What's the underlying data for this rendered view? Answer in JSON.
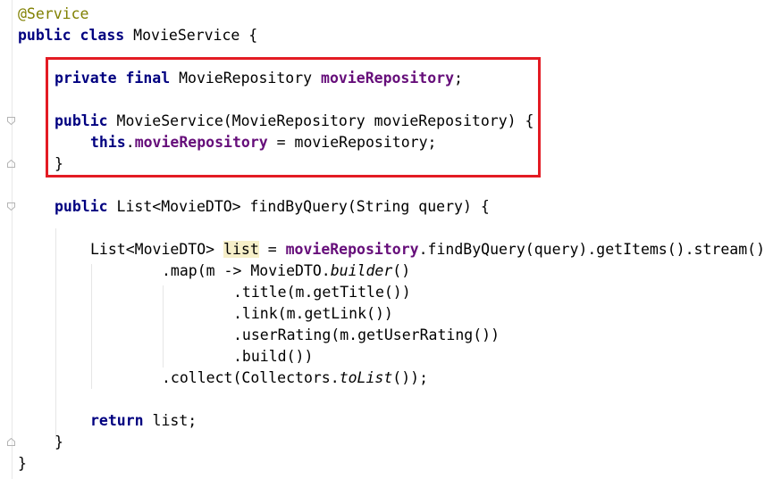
{
  "code": {
    "l1_annotation": "@Service",
    "l2_kw": "public class",
    "l2_rest": " MovieService {",
    "l3_kw": "private final",
    "l3_type": " MovieRepository ",
    "l3_field": "movieRepository",
    "l3_end": ";",
    "l4_kw": "public",
    "l4_rest": " MovieService(MovieRepository movieRepository) {",
    "l5_kw": "this",
    "l5_dot": ".",
    "l5_field": "movieRepository",
    "l5_rest": " = movieRepository;",
    "l6": "}",
    "l7_kw": "public",
    "l7_rest": " List<MovieDTO> findByQuery(String query) {",
    "l8_a": "List<MovieDTO> ",
    "l8_var": "list",
    "l8_b": " = ",
    "l8_field": "movieRepository",
    "l8_c": ".findByQuery(query).getItems().stream()",
    "l9_a": ".map(m -> MovieDTO.",
    "l9_italic": "builder",
    "l9_b": "()",
    "l10": ".title(m.getTitle())",
    "l11": ".link(m.getLink())",
    "l12": ".userRating(m.getUserRating())",
    "l13": ".build())",
    "l14_a": ".collect(Collectors.",
    "l14_italic": "toList",
    "l14_b": "());",
    "l15_kw": "return",
    "l15_rest": " list;",
    "l16": "}",
    "l17": "}"
  },
  "colors": {
    "keyword": "#000080",
    "annotation": "#808000",
    "field": "#660e7a",
    "highlight": "#f6efc9",
    "box": "#e31b23"
  }
}
